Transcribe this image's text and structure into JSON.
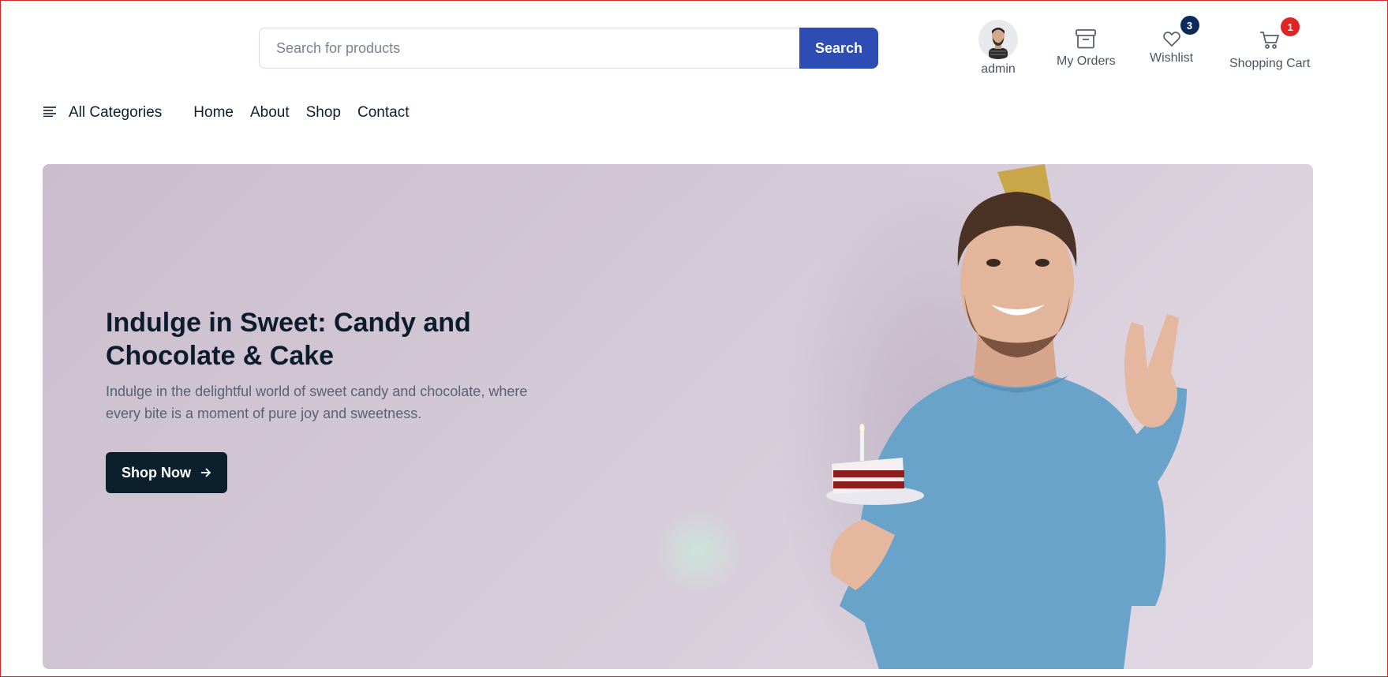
{
  "search": {
    "placeholder": "Search for products",
    "button_label": "Search"
  },
  "header": {
    "user": {
      "label": "admin",
      "icon": "avatar"
    },
    "orders": {
      "label": "My Orders",
      "icon": "archive-box-icon"
    },
    "wishlist": {
      "label": "Wishlist",
      "icon": "heart-icon",
      "count": "3",
      "badge_color": "#0b2a5b"
    },
    "cart": {
      "label": "Shopping Cart",
      "icon": "cart-icon",
      "count": "1",
      "badge_color": "#e02424"
    }
  },
  "nav": {
    "categories_label": "All Categories",
    "links": [
      "Home",
      "About",
      "Shop",
      "Contact"
    ]
  },
  "hero": {
    "title": "Indulge in Sweet: Candy and Chocolate & Cake",
    "subtitle": "Indulge in the delightful world of sweet candy and chocolate, where every bite is a moment of pure joy and sweetness.",
    "button_label": "Shop Now"
  },
  "colors": {
    "accent": "#2d4db5",
    "dark": "#0b1f2c",
    "cart_badge": "#e02424",
    "wishlist_badge": "#0b2a5b",
    "hero_bg": "#d3c8d6"
  }
}
